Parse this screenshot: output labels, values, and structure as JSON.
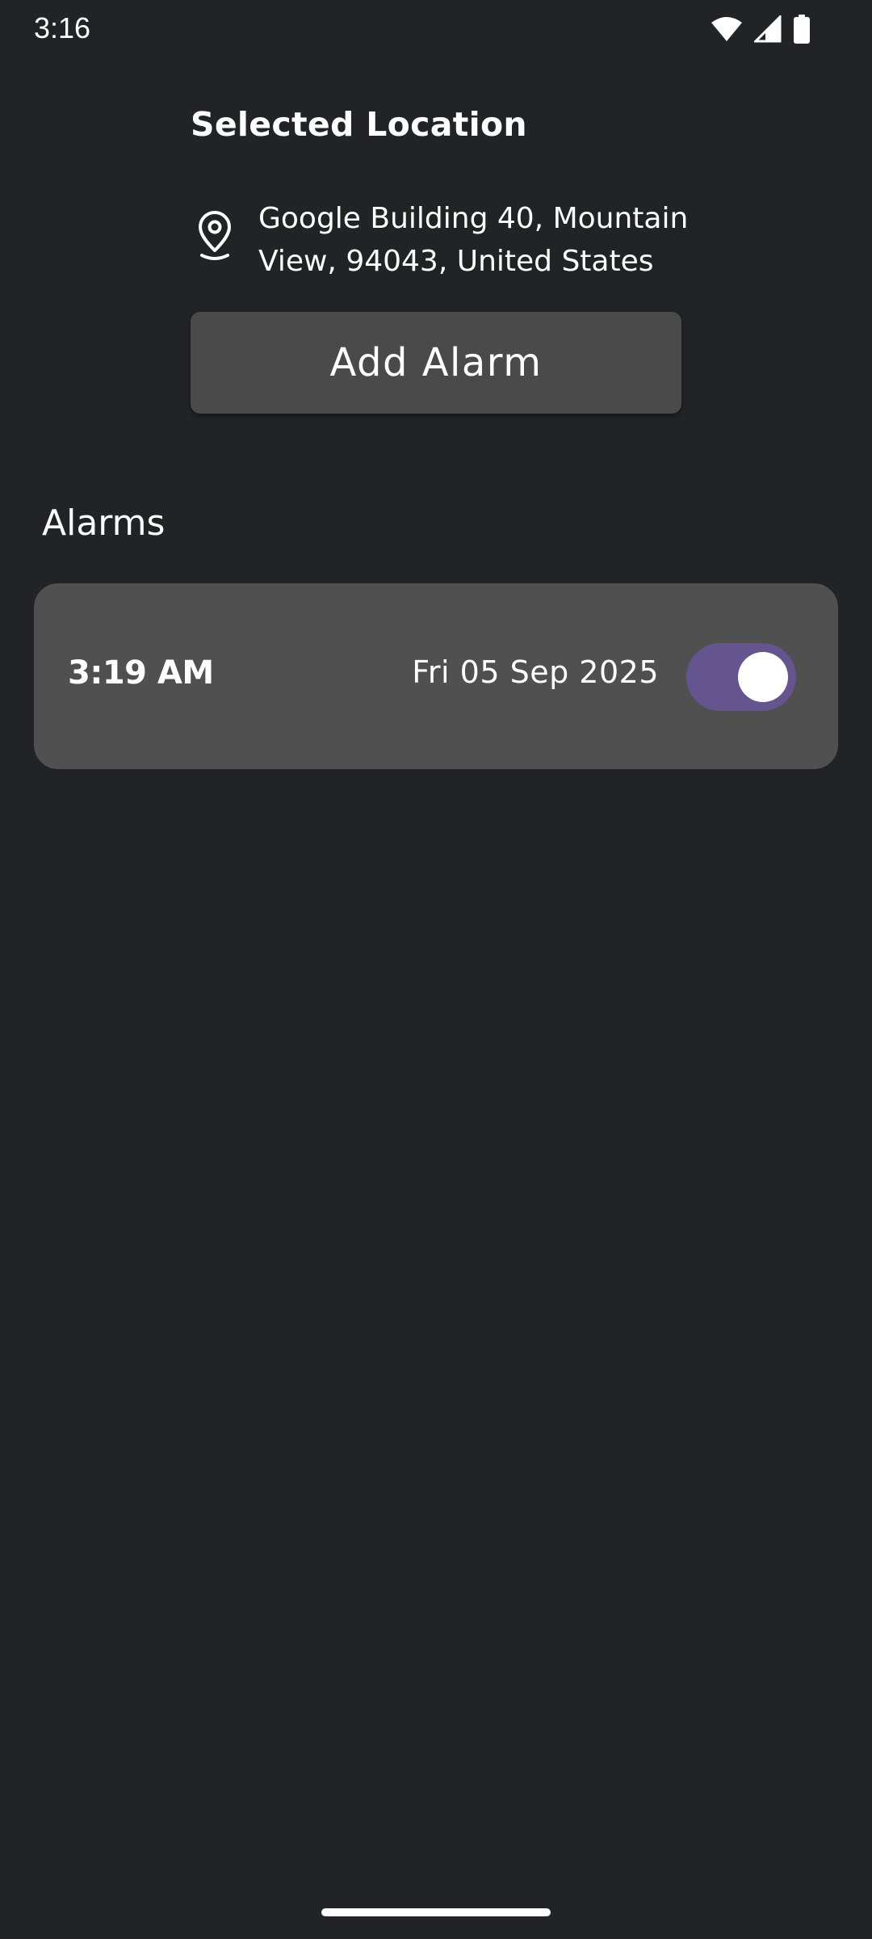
{
  "status_bar": {
    "time": "3:16",
    "icons": [
      "wifi-icon",
      "cellular-signal-icon",
      "battery-icon"
    ]
  },
  "location": {
    "title": "Selected Location",
    "icon": "location-pin-icon",
    "address": "Google Building 40, Mountain View, 94043, United States"
  },
  "add_alarm": {
    "label": "Add Alarm"
  },
  "alarms": {
    "heading": "Alarms",
    "items": [
      {
        "time": "3:19 AM",
        "date": "Fri 05 Sep 2025",
        "enabled": true
      }
    ]
  },
  "colors": {
    "background": "#222327",
    "card": "#505050",
    "button": "#4a4a4a",
    "toggle_track_on": "#65558f",
    "text": "#ffffff"
  }
}
